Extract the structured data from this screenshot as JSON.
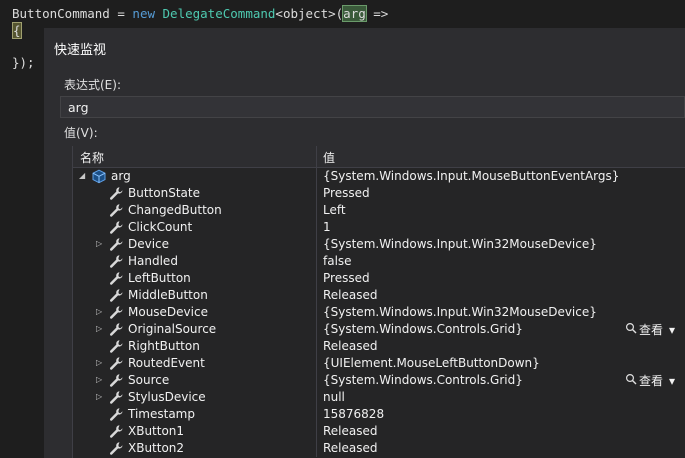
{
  "editor": {
    "line1": {
      "lhs": "ButtonCommand = ",
      "kw_new": "new",
      "type": "DelegateCommand",
      "generic": "<object>",
      "open": "(",
      "arg": "arg",
      "arrow": " =>"
    },
    "line2": {
      "brace": "{"
    },
    "line3": {
      "close": "});"
    }
  },
  "dialog": {
    "title": "快速监视",
    "expression_label": "表达式(E):",
    "expression_value": "arg",
    "value_label": "值(V):",
    "columns": {
      "name": "名称",
      "value": "值"
    },
    "viewer_label": "查看",
    "rows": [
      {
        "name": "arg",
        "value": "{System.Windows.Input.MouseButtonEventArgs}",
        "level": 0,
        "arrow": "expanded",
        "icon": "object-cube-icon"
      },
      {
        "name": "ButtonState",
        "value": "Pressed",
        "level": 1,
        "arrow": "none",
        "icon": "wrench-icon"
      },
      {
        "name": "ChangedButton",
        "value": "Left",
        "level": 1,
        "arrow": "none",
        "icon": "wrench-icon"
      },
      {
        "name": "ClickCount",
        "value": "1",
        "level": 1,
        "arrow": "none",
        "icon": "wrench-icon"
      },
      {
        "name": "Device",
        "value": "{System.Windows.Input.Win32MouseDevice}",
        "level": 1,
        "arrow": "collapsed",
        "icon": "wrench-icon"
      },
      {
        "name": "Handled",
        "value": "false",
        "level": 1,
        "arrow": "none",
        "icon": "wrench-icon"
      },
      {
        "name": "LeftButton",
        "value": "Pressed",
        "level": 1,
        "arrow": "none",
        "icon": "wrench-icon"
      },
      {
        "name": "MiddleButton",
        "value": "Released",
        "level": 1,
        "arrow": "none",
        "icon": "wrench-icon"
      },
      {
        "name": "MouseDevice",
        "value": "{System.Windows.Input.Win32MouseDevice}",
        "level": 1,
        "arrow": "collapsed",
        "icon": "wrench-icon"
      },
      {
        "name": "OriginalSource",
        "value": "{System.Windows.Controls.Grid}",
        "level": 1,
        "arrow": "collapsed",
        "icon": "wrench-icon",
        "viewer": true
      },
      {
        "name": "RightButton",
        "value": "Released",
        "level": 1,
        "arrow": "none",
        "icon": "wrench-icon"
      },
      {
        "name": "RoutedEvent",
        "value": "{UIElement.MouseLeftButtonDown}",
        "level": 1,
        "arrow": "collapsed",
        "icon": "wrench-icon"
      },
      {
        "name": "Source",
        "value": "{System.Windows.Controls.Grid}",
        "level": 1,
        "arrow": "collapsed",
        "icon": "wrench-icon",
        "viewer": true
      },
      {
        "name": "StylusDevice",
        "value": "null",
        "level": 1,
        "arrow": "collapsed",
        "icon": "wrench-icon"
      },
      {
        "name": "Timestamp",
        "value": "15876828",
        "level": 1,
        "arrow": "none",
        "icon": "wrench-icon"
      },
      {
        "name": "XButton1",
        "value": "Released",
        "level": 1,
        "arrow": "none",
        "icon": "wrench-icon"
      },
      {
        "name": "XButton2",
        "value": "Released",
        "level": 1,
        "arrow": "none",
        "icon": "wrench-icon"
      }
    ]
  },
  "colors": {
    "keyword": "#569cd6",
    "type": "#4ec9b0",
    "dialog_bg": "#2d2d30",
    "grid_bg": "#252526"
  }
}
